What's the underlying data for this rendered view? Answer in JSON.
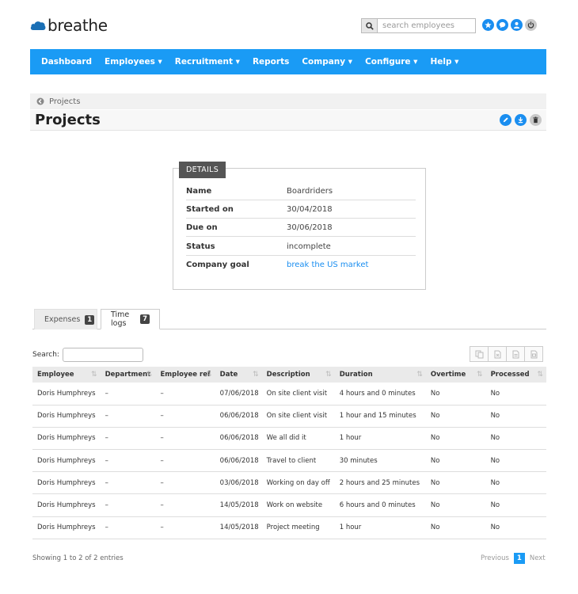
{
  "header": {
    "logo_text": "breathe",
    "search_placeholder": "search employees"
  },
  "nav": {
    "items": [
      {
        "label": "Dashboard"
      },
      {
        "label": "Employees ▾"
      },
      {
        "label": "Recruitment ▾"
      },
      {
        "label": "Reports"
      },
      {
        "label": "Company ▾"
      },
      {
        "label": "Configure ▾"
      },
      {
        "label": "Help ▾"
      }
    ]
  },
  "breadcrumb": {
    "label": "Projects"
  },
  "page": {
    "title": "Projects"
  },
  "details": {
    "label": "DETAILS",
    "rows": [
      {
        "key": "Name",
        "value": "Boardriders"
      },
      {
        "key": "Started on",
        "value": "30/04/2018"
      },
      {
        "key": "Due on",
        "value": "30/06/2018"
      },
      {
        "key": "Status",
        "value": "incomplete"
      },
      {
        "key": "Company goal",
        "value": "break the US market"
      }
    ]
  },
  "tabs": [
    {
      "label": "Expenses",
      "count": "1"
    },
    {
      "label": "Time logs",
      "count": "7"
    }
  ],
  "table": {
    "search_label": "Search:",
    "columns": [
      "Employee",
      "Department",
      "Employee ref",
      "Date",
      "Description",
      "Duration",
      "Overtime",
      "Processed"
    ],
    "rows": [
      [
        "Doris Humphreys",
        "–",
        "–",
        "07/06/2018",
        "On site client visit",
        "4 hours and 0 minutes",
        "No",
        "No"
      ],
      [
        "Doris Humphreys",
        "–",
        "–",
        "06/06/2018",
        "On site client visit",
        "1 hour and 15 minutes",
        "No",
        "No"
      ],
      [
        "Doris Humphreys",
        "–",
        "–",
        "06/06/2018",
        "We all did it",
        "1 hour",
        "No",
        "No"
      ],
      [
        "Doris Humphreys",
        "–",
        "–",
        "06/06/2018",
        "Travel to client",
        "30 minutes",
        "No",
        "No"
      ],
      [
        "Doris Humphreys",
        "–",
        "–",
        "03/06/2018",
        "Working on day off",
        "2 hours and 25 minutes",
        "No",
        "No"
      ],
      [
        "Doris Humphreys",
        "–",
        "–",
        "14/05/2018",
        "Work on website",
        "6 hours and 0 minutes",
        "No",
        "No"
      ],
      [
        "Doris Humphreys",
        "–",
        "–",
        "14/05/2018",
        "Project meeting",
        "1 hour",
        "No",
        "No"
      ]
    ],
    "showing": "Showing 1 to 2 of 2 entries",
    "pager": {
      "previous": "Previous",
      "current": "1",
      "next": "Next"
    }
  },
  "colors": {
    "accent": "#1a9bf5",
    "link": "#1a8ef0"
  }
}
